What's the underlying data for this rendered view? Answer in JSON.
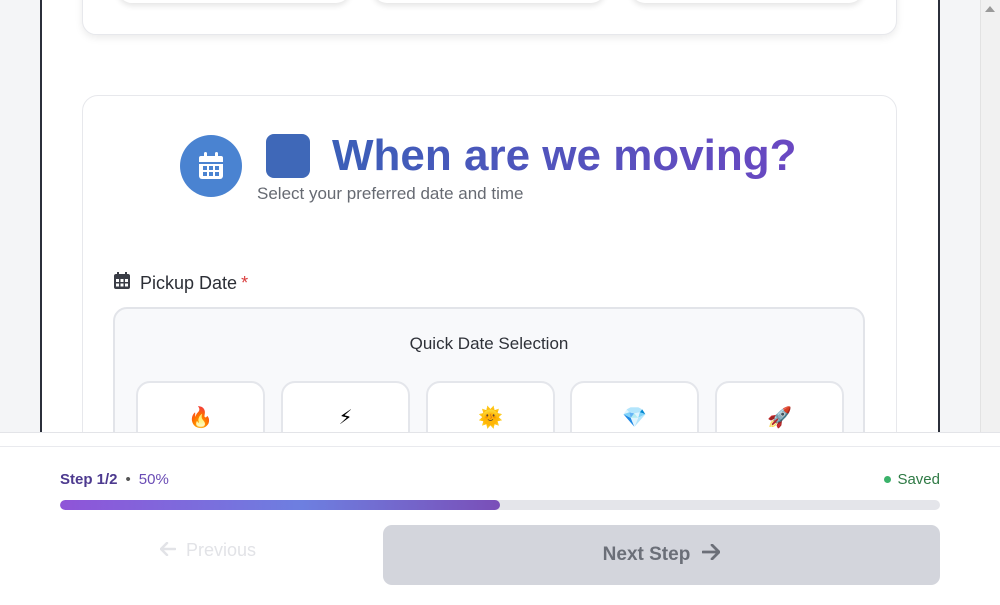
{
  "hero": {
    "title": "When are we moving?",
    "subtitle": "Select your preferred date and time"
  },
  "pickup": {
    "label": "Pickup Date",
    "required_mark": "*"
  },
  "quick_dates": {
    "title": "Quick Date Selection",
    "options": [
      {
        "emoji": "🔥",
        "icon": "fire-icon"
      },
      {
        "emoji": "⚡",
        "icon": "lightning-icon"
      },
      {
        "emoji": "🌞",
        "icon": "sun-icon"
      },
      {
        "emoji": "💎",
        "icon": "diamond-icon"
      },
      {
        "emoji": "🚀",
        "icon": "rocket-icon"
      }
    ]
  },
  "progress": {
    "step_label": "Step 1/2",
    "separator": "•",
    "percent_label": "50%",
    "percent": 50,
    "saved_label": "Saved"
  },
  "nav": {
    "previous_label": "Previous",
    "next_label": "Next Step"
  },
  "colors": {
    "accent_blue": "#4a83d1",
    "accent_purple": "#6a47c2",
    "saved_green": "#3ab26a",
    "required_red": "#d93b3b"
  }
}
